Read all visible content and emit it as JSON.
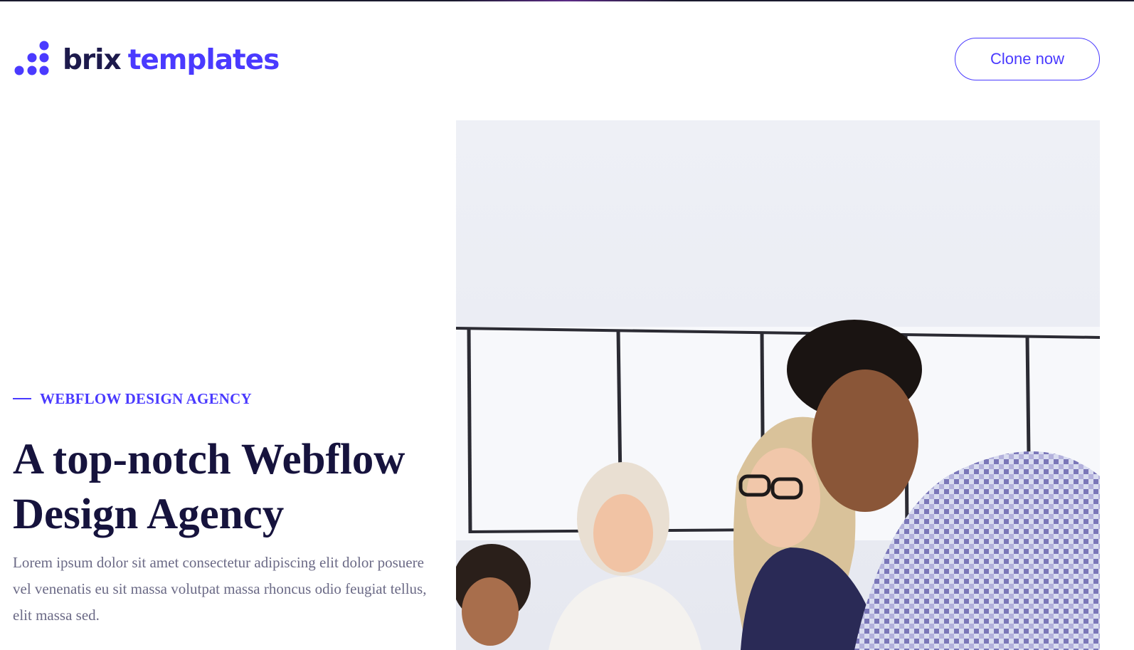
{
  "brand": {
    "name_part1": "brix",
    "name_part2": "templates",
    "primary_color": "#4a3aff",
    "dark_color": "#1d1a4c",
    "logo_icon": "brix-dots-logo-icon"
  },
  "header": {
    "clone_button_label": "Clone now"
  },
  "hero": {
    "eyebrow": "WEBFLOW DESIGN AGENCY",
    "headline_line1": "A top-notch Webflow",
    "headline_line2": "Design Agency",
    "lead": "Lorem ipsum dolor sit amet consectetur adipiscing elit dolor posuere vel venenatis eu sit massa volutpat massa rhoncus odio feugiat tellus, elit massa sed.",
    "image_icon": "team-photo"
  }
}
